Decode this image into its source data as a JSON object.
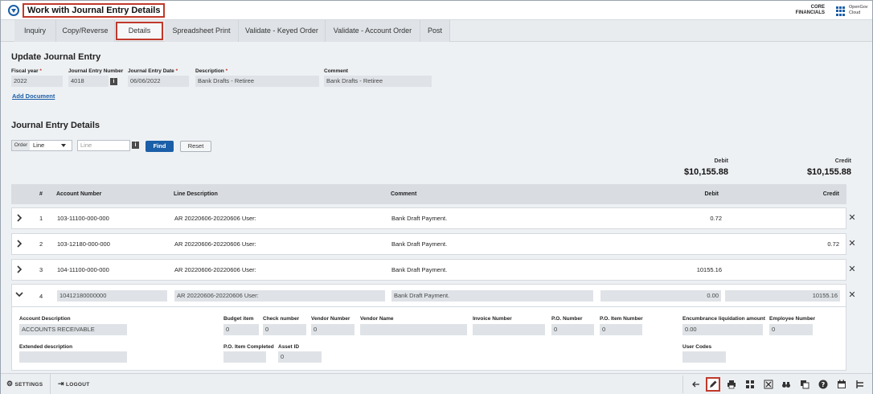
{
  "header": {
    "title": "Work with Journal Entry Details",
    "brand_line1": "CORE",
    "brand_line2": "FINANCIALS",
    "cloud_line1": "OpenGov",
    "cloud_line2": "Cloud"
  },
  "tabs": [
    {
      "label": "Inquiry"
    },
    {
      "label": "Copy/Reverse"
    },
    {
      "label": "Details",
      "active": true
    },
    {
      "label": "Spreadsheet Print"
    },
    {
      "label": "Validate - Keyed Order"
    },
    {
      "label": "Validate - Account Order"
    },
    {
      "label": "Post"
    }
  ],
  "update_section": {
    "title": "Update Journal Entry",
    "fields": {
      "fiscal_year": {
        "label": "Fiscal year",
        "value": "2022"
      },
      "je_number": {
        "label": "Journal Entry Number",
        "value": "4018"
      },
      "je_date": {
        "label": "Journal Entry Date",
        "value": "06/06/2022"
      },
      "description": {
        "label": "Description",
        "value": "Bank Drafts - Retiree"
      },
      "comment": {
        "label": "Comment",
        "value": "Bank Drafts - Retiree"
      }
    },
    "add_document": "Add Document"
  },
  "details_section": {
    "title": "Journal Entry Details",
    "order_label": "Order",
    "order_value": "Line",
    "line_placeholder": "Line",
    "find_label": "Find",
    "reset_label": "Reset",
    "totals": {
      "debit_label": "Debit",
      "debit_value": "$10,155.88",
      "credit_label": "Credit",
      "credit_value": "$10,155.88"
    },
    "columns": {
      "num": "#",
      "account": "Account Number",
      "line_desc": "Line Description",
      "comment": "Comment",
      "debit": "Debit",
      "credit": "Credit"
    },
    "rows": [
      {
        "num": "1",
        "account": "103-11100-000-000",
        "line_desc": "AR 20220606-20220606 User:",
        "comment": "Bank Draft Payment.",
        "debit": "0.72",
        "credit": ""
      },
      {
        "num": "2",
        "account": "103-12180-000-000",
        "line_desc": "AR 20220606-20220606 User:",
        "comment": "Bank Draft Payment.",
        "debit": "",
        "credit": "0.72"
      },
      {
        "num": "3",
        "account": "104-11100-000-000",
        "line_desc": "AR 20220606-20220606 User:",
        "comment": "Bank Draft Payment.",
        "debit": "10155.16",
        "credit": ""
      }
    ],
    "expanded_row": {
      "num": "4",
      "account": "10412180000000",
      "line_desc": "AR 20220606-20220606 User:",
      "comment": "Bank Draft Payment.",
      "debit": "0.00",
      "credit": "10155.16",
      "detail": {
        "account_description": {
          "label": "Account Description",
          "value": "ACCOUNTS RECEIVABLE"
        },
        "budget_item": {
          "label": "Budget item",
          "value": "0"
        },
        "check_number": {
          "label": "Check number",
          "value": "0"
        },
        "vendor_number": {
          "label": "Vendor Number",
          "value": "0"
        },
        "vendor_name": {
          "label": "Vendor Name",
          "value": ""
        },
        "invoice_number": {
          "label": "Invoice Number",
          "value": ""
        },
        "po_number": {
          "label": "P.O. Number",
          "value": "0"
        },
        "po_item_number": {
          "label": "P.O. Item Number",
          "value": "0"
        },
        "encumbrance": {
          "label": "Encumbrance liquidation amount",
          "value": "0.00"
        },
        "employee_number": {
          "label": "Employee Number",
          "value": "0"
        },
        "extended_description": {
          "label": "Extended description",
          "value": ""
        },
        "po_item_completed": {
          "label": "P.O. Item Completed",
          "value": ""
        },
        "asset_id": {
          "label": "Asset ID",
          "value": "0"
        },
        "user_codes": {
          "label": "User Codes",
          "value": ""
        }
      }
    }
  },
  "footer": {
    "settings_label": "SETTINGS",
    "logout_label": "LOGOUT"
  },
  "toolbar_icons": [
    "back-arrow-icon",
    "edit-pencil-icon",
    "print-icon",
    "grid-view-icon",
    "excel-icon",
    "binoculars-icon",
    "copy-icon",
    "help-icon",
    "calendar-icon",
    "tree-icon"
  ],
  "colors": {
    "accent": "#1b5fa8",
    "highlight_border": "#c0392b",
    "background": "#eef1f4"
  }
}
